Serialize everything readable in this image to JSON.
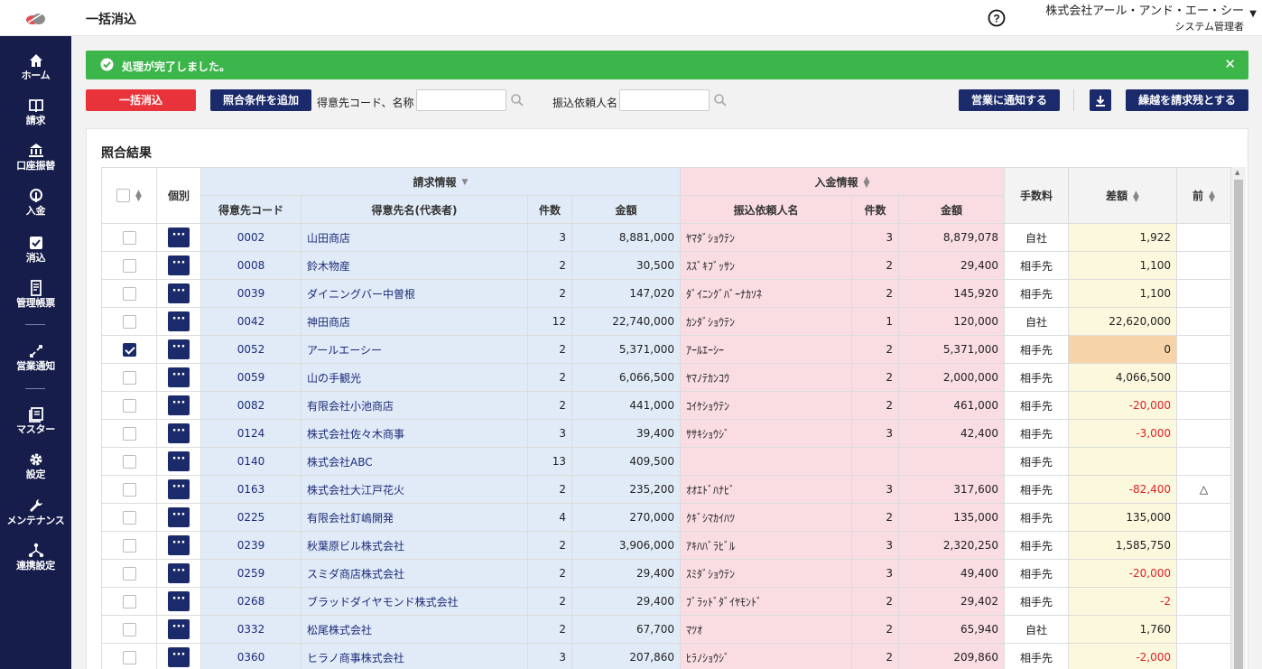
{
  "header": {
    "title": "一括消込",
    "company": "株式会社アール・アンド・エー・シー",
    "role": "システム管理者"
  },
  "sidebar": {
    "items": [
      {
        "label": "ホーム",
        "icon": "home-icon"
      },
      {
        "label": "請求",
        "icon": "book-icon"
      },
      {
        "label": "口座振替",
        "icon": "bank-icon"
      },
      {
        "label": "入金",
        "icon": "deposit-icon"
      },
      {
        "label": "消込",
        "icon": "check-square-icon"
      },
      {
        "label": "管理帳票",
        "icon": "report-icon"
      },
      {
        "label": "営業通知",
        "icon": "notify-icon"
      },
      {
        "label": "マスター",
        "icon": "master-icon"
      },
      {
        "label": "設定",
        "icon": "gear-icon"
      },
      {
        "label": "メンテナンス",
        "icon": "wrench-icon"
      },
      {
        "label": "連携設定",
        "icon": "network-icon"
      }
    ]
  },
  "alert": {
    "message": "処理が完了しました。"
  },
  "toolbar": {
    "bulk_label": "一括消込",
    "add_cond_label": "照合条件を追加",
    "customer_label": "得意先コード、名称",
    "customer_value": "",
    "payer_label": "振込依頼人名",
    "payer_value": "",
    "notify_label": "営業に通知する",
    "carry_label": "繰越を請求残とする"
  },
  "panel": {
    "title": "照合結果"
  },
  "table": {
    "group_headers": {
      "individual": "個別",
      "billing": "請求情報",
      "deposit": "入金情報",
      "fee": "手数料",
      "diff": "差額",
      "prev": "前"
    },
    "headers": {
      "code": "得意先コード",
      "name": "得意先名(代表者)",
      "bill_count": "件数",
      "bill_amount": "金額",
      "payer": "振込依頼人名",
      "dep_count": "件数",
      "dep_amount": "金額"
    },
    "rows": [
      {
        "checked": false,
        "code": "0002",
        "name": "山田商店",
        "bill_count": "3",
        "bill_amount": "8,881,000",
        "payer": "ﾔﾏﾀﾞｼｮｳﾃﾝ",
        "dep_count": "3",
        "dep_amount": "8,879,078",
        "fee": "自社",
        "diff": "1,922",
        "neg": false,
        "prev": ""
      },
      {
        "checked": false,
        "code": "0008",
        "name": "鈴木物産",
        "bill_count": "2",
        "bill_amount": "30,500",
        "payer": "ｽｽﾞｷﾌﾞｯｻﾝ",
        "dep_count": "2",
        "dep_amount": "29,400",
        "fee": "相手先",
        "diff": "1,100",
        "neg": false,
        "prev": ""
      },
      {
        "checked": false,
        "code": "0039",
        "name": "ダイニングバー中曽根",
        "bill_count": "2",
        "bill_amount": "147,020",
        "payer": "ﾀﾞｲﾆﾝｸﾞﾊﾞｰﾅｶｿﾈ",
        "dep_count": "2",
        "dep_amount": "145,920",
        "fee": "相手先",
        "diff": "1,100",
        "neg": false,
        "prev": ""
      },
      {
        "checked": false,
        "code": "0042",
        "name": "神田商店",
        "bill_count": "12",
        "bill_amount": "22,740,000",
        "payer": "ｶﾝﾀﾞｼｮｳﾃﾝ",
        "dep_count": "1",
        "dep_amount": "120,000",
        "fee": "自社",
        "diff": "22,620,000",
        "neg": false,
        "prev": ""
      },
      {
        "checked": true,
        "code": "0052",
        "name": "アールエーシー",
        "bill_count": "2",
        "bill_amount": "5,371,000",
        "payer": "ｱｰﾙｴｰｼｰ",
        "dep_count": "2",
        "dep_amount": "5,371,000",
        "fee": "相手先",
        "diff": "0",
        "neg": false,
        "prev": ""
      },
      {
        "checked": false,
        "code": "0059",
        "name": "山の手観光",
        "bill_count": "2",
        "bill_amount": "6,066,500",
        "payer": "ﾔﾏﾉﾃｶﾝｺｳ",
        "dep_count": "2",
        "dep_amount": "2,000,000",
        "fee": "相手先",
        "diff": "4,066,500",
        "neg": false,
        "prev": ""
      },
      {
        "checked": false,
        "code": "0082",
        "name": "有限会社小池商店",
        "bill_count": "2",
        "bill_amount": "441,000",
        "payer": "ｺｲｹｼｮｳﾃﾝ",
        "dep_count": "2",
        "dep_amount": "461,000",
        "fee": "相手先",
        "diff": "-20,000",
        "neg": true,
        "prev": ""
      },
      {
        "checked": false,
        "code": "0124",
        "name": "株式会社佐々木商事",
        "bill_count": "3",
        "bill_amount": "39,400",
        "payer": "ｻｻｷｼｮｳｼﾞ",
        "dep_count": "3",
        "dep_amount": "42,400",
        "fee": "相手先",
        "diff": "-3,000",
        "neg": true,
        "prev": ""
      },
      {
        "checked": false,
        "code": "0140",
        "name": "株式会社ABC",
        "bill_count": "13",
        "bill_amount": "409,500",
        "payer": "",
        "dep_count": "",
        "dep_amount": "",
        "fee": "相手先",
        "diff": "",
        "neg": false,
        "prev": ""
      },
      {
        "checked": false,
        "code": "0163",
        "name": "株式会社大江戸花火",
        "bill_count": "2",
        "bill_amount": "235,200",
        "payer": "ｵｵｴﾄﾞﾊﾅﾋﾞ",
        "dep_count": "3",
        "dep_amount": "317,600",
        "fee": "相手先",
        "diff": "-82,400",
        "neg": true,
        "prev": "△"
      },
      {
        "checked": false,
        "code": "0225",
        "name": "有限会社釘嶋開発",
        "bill_count": "4",
        "bill_amount": "270,000",
        "payer": "ｸｷﾞｼﾏｶｲﾊﾂ",
        "dep_count": "2",
        "dep_amount": "135,000",
        "fee": "相手先",
        "diff": "135,000",
        "neg": false,
        "prev": ""
      },
      {
        "checked": false,
        "code": "0239",
        "name": "秋葉原ビル株式会社",
        "bill_count": "2",
        "bill_amount": "3,906,000",
        "payer": "ｱｷﾊﾊﾞﾗﾋﾞﾙ",
        "dep_count": "3",
        "dep_amount": "2,320,250",
        "fee": "相手先",
        "diff": "1,585,750",
        "neg": false,
        "prev": ""
      },
      {
        "checked": false,
        "code": "0259",
        "name": "スミダ商店株式会社",
        "bill_count": "2",
        "bill_amount": "29,400",
        "payer": "ｽﾐﾀﾞｼｮｳﾃﾝ",
        "dep_count": "3",
        "dep_amount": "49,400",
        "fee": "相手先",
        "diff": "-20,000",
        "neg": true,
        "prev": ""
      },
      {
        "checked": false,
        "code": "0268",
        "name": "ブラッドダイヤモンド株式会社",
        "bill_count": "2",
        "bill_amount": "29,400",
        "payer": "ﾌﾞﾗｯﾄﾞﾀﾞｲﾔﾓﾝﾄﾞ",
        "dep_count": "2",
        "dep_amount": "29,402",
        "fee": "相手先",
        "diff": "-2",
        "neg": true,
        "prev": ""
      },
      {
        "checked": false,
        "code": "0332",
        "name": "松尾株式会社",
        "bill_count": "2",
        "bill_amount": "67,700",
        "payer": "ﾏﾂｵ",
        "dep_count": "2",
        "dep_amount": "65,940",
        "fee": "自社",
        "diff": "1,760",
        "neg": false,
        "prev": ""
      },
      {
        "checked": false,
        "code": "0360",
        "name": "ヒラノ商事株式会社",
        "bill_count": "3",
        "bill_amount": "207,860",
        "payer": "ﾋﾗﾉｼｮｳｼﾞ",
        "dep_count": "2",
        "dep_amount": "209,860",
        "fee": "相手先",
        "diff": "-2,000",
        "neg": true,
        "prev": ""
      }
    ]
  },
  "colors": {
    "sidebar": "#161d4a",
    "navy": "#1b2a6b",
    "alert_green": "#3cb54a",
    "danger_red": "#e8333b",
    "billing_bg": "#e0ebf7",
    "deposit_bg": "#f9dde2",
    "diff_bg": "#fbf8de",
    "negative": "#e11f24"
  }
}
